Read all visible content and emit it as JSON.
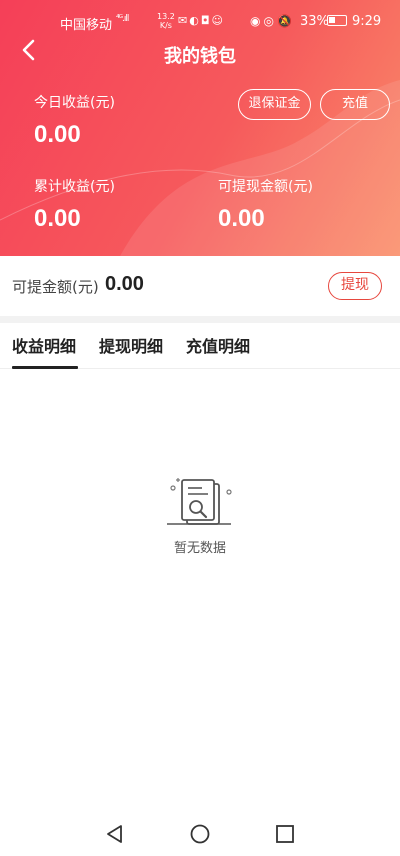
{
  "status_bar": {
    "carrier": "中国移动",
    "network": "⁴ᴳ.ıll",
    "speed_value": "13.2",
    "speed_unit": "K/s",
    "app_icons": "✉◐◘☺",
    "right_icons": "◉◎🔕",
    "battery": "33%",
    "time": "9:29"
  },
  "header": {
    "title": "我的钱包",
    "back_icon": "chevron-left-icon"
  },
  "wallet": {
    "today_label": "今日收益(元)",
    "today_value": "0.00",
    "total_label": "累计收益(元)",
    "total_value": "0.00",
    "withdrawable_label": "可提现金额(元)",
    "withdrawable_value": "0.00",
    "refund_deposit_label": "退保证金",
    "recharge_label": "充值"
  },
  "withdraw_row": {
    "label": "可提金额(元)",
    "amount": "0.00",
    "button_label": "提现"
  },
  "tabs": [
    {
      "label": "收益明细",
      "active": true
    },
    {
      "label": "提现明细",
      "active": false
    },
    {
      "label": "充值明细",
      "active": false
    }
  ],
  "empty_state": {
    "icon": "document-search-icon",
    "text": "暂无数据"
  },
  "nav_bar": {
    "back": "triangle-back-icon",
    "home": "circle-home-icon",
    "recents": "square-recents-icon"
  },
  "colors": {
    "gradient_start": "#f53f58",
    "gradient_end": "#fa8f6a",
    "accent": "#e7473e"
  }
}
